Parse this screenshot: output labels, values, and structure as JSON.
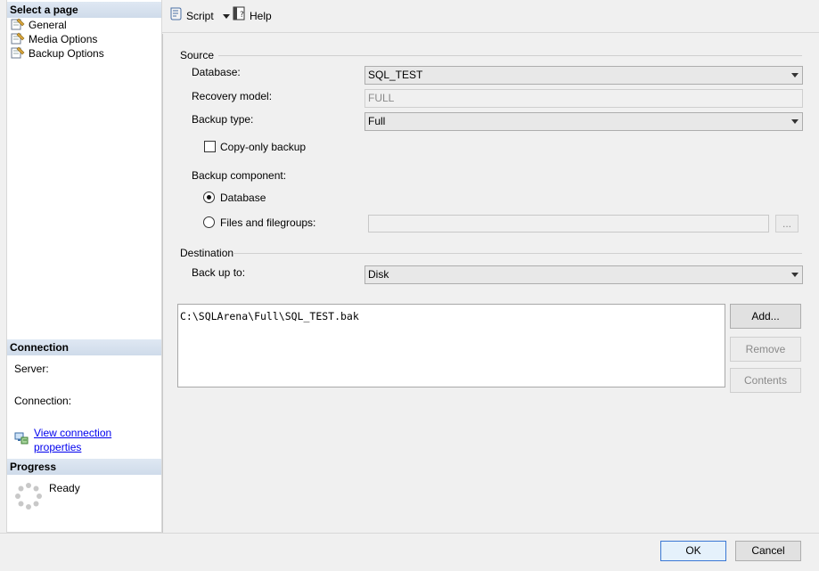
{
  "left_pane": {
    "select_page_header": "Select a page",
    "pages": [
      {
        "label": "General",
        "icon": "page-wrench-icon"
      },
      {
        "label": "Media Options",
        "icon": "page-wrench-icon"
      },
      {
        "label": "Backup Options",
        "icon": "page-wrench-icon"
      }
    ],
    "connection_header": "Connection",
    "server_label": "Server:",
    "connection_label": "Connection:",
    "view_connection_link": "View connection properties",
    "progress_header": "Progress",
    "progress_status": "Ready"
  },
  "toolbar": {
    "script_label": "Script",
    "help_label": "Help"
  },
  "source": {
    "group_label": "Source",
    "database_label": "Database:",
    "database_value": "SQL_TEST",
    "recovery_label": "Recovery model:",
    "recovery_value": "FULL",
    "backup_type_label": "Backup type:",
    "backup_type_value": "Full",
    "copy_only_label": "Copy-only backup",
    "copy_only_checked": false,
    "component_label": "Backup component:",
    "component_database_label": "Database",
    "component_files_label": "Files and filegroups:",
    "selected_component": "Database",
    "browse_label": "..."
  },
  "destination": {
    "group_label": "Destination",
    "back_up_to_label": "Back up to:",
    "back_up_to_value": "Disk",
    "paths": [
      "C:\\SQLArena\\Full\\SQL_TEST.bak"
    ],
    "add_label": "Add...",
    "remove_label": "Remove",
    "contents_label": "Contents"
  },
  "footer": {
    "ok_label": "OK",
    "cancel_label": "Cancel"
  }
}
